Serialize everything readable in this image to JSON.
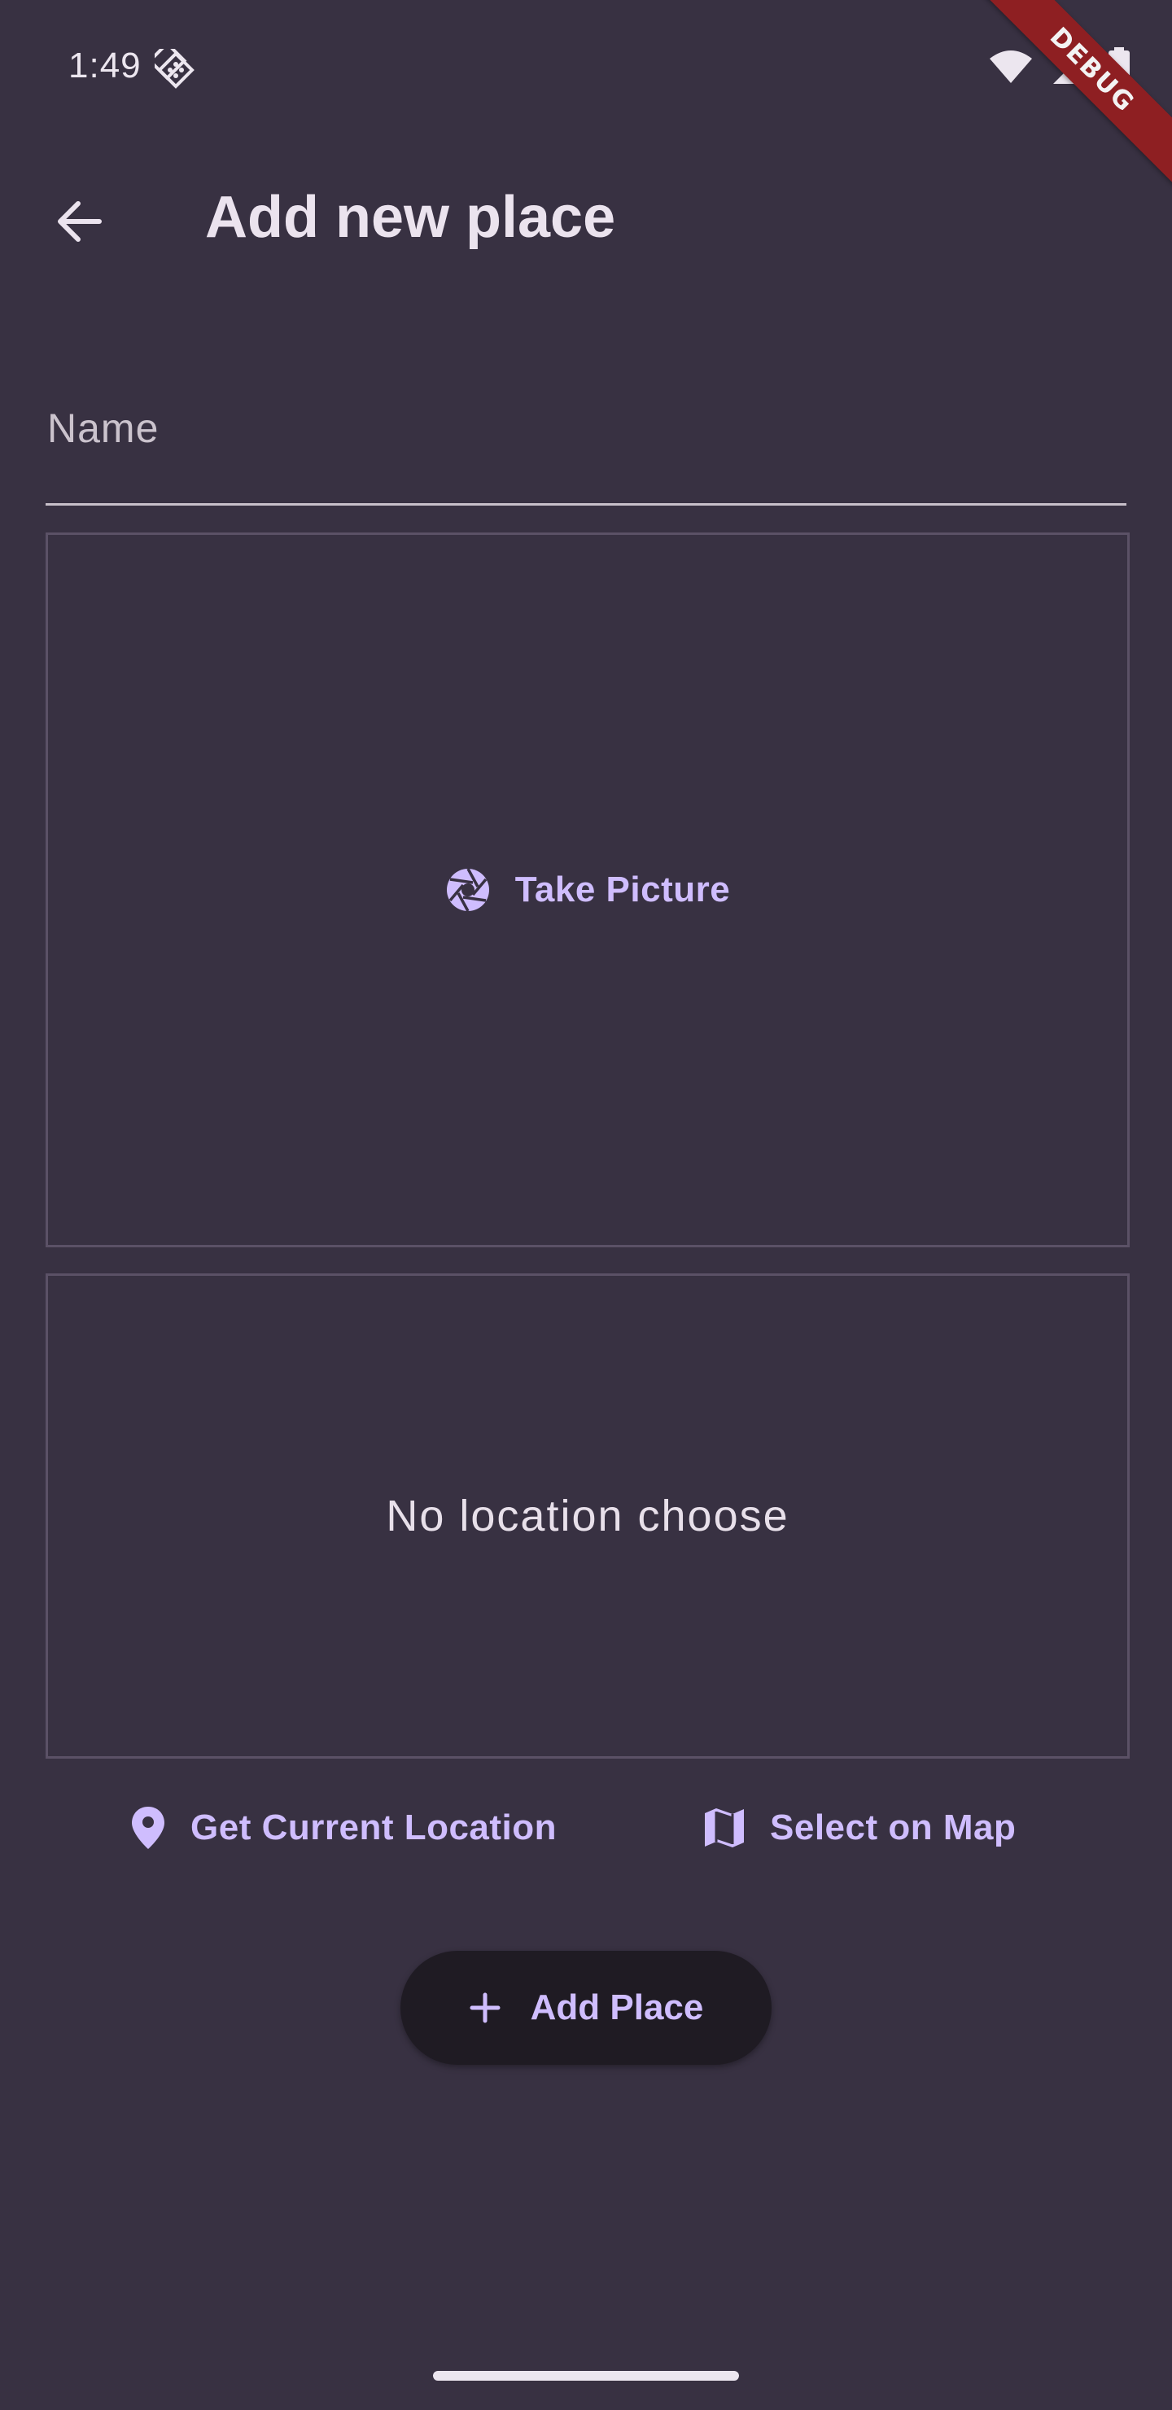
{
  "status_bar": {
    "time": "1:49",
    "icons": [
      "app-notification-icon",
      "wifi-icon",
      "cellular-signal-icon",
      "battery-icon"
    ]
  },
  "debug_banner": "DEBUG",
  "app_bar": {
    "title": "Add new place",
    "back_icon": "arrow-back-icon"
  },
  "form": {
    "name_placeholder": "Name",
    "name_value": "",
    "take_picture_label": "Take Picture",
    "take_picture_icon": "camera-aperture-icon",
    "no_location_text": "No location choose",
    "get_location_label": "Get Current Location",
    "get_location_icon": "location-pin-icon",
    "select_map_label": "Select on Map",
    "select_map_icon": "map-icon",
    "add_place_label": "Add Place",
    "add_place_icon": "plus-icon"
  },
  "colors": {
    "background": "#383142",
    "accent": "#cfbdfe",
    "box_border": "#5b5166",
    "button_bg": "#1f1b23",
    "debug_banner": "#8e1f22"
  }
}
